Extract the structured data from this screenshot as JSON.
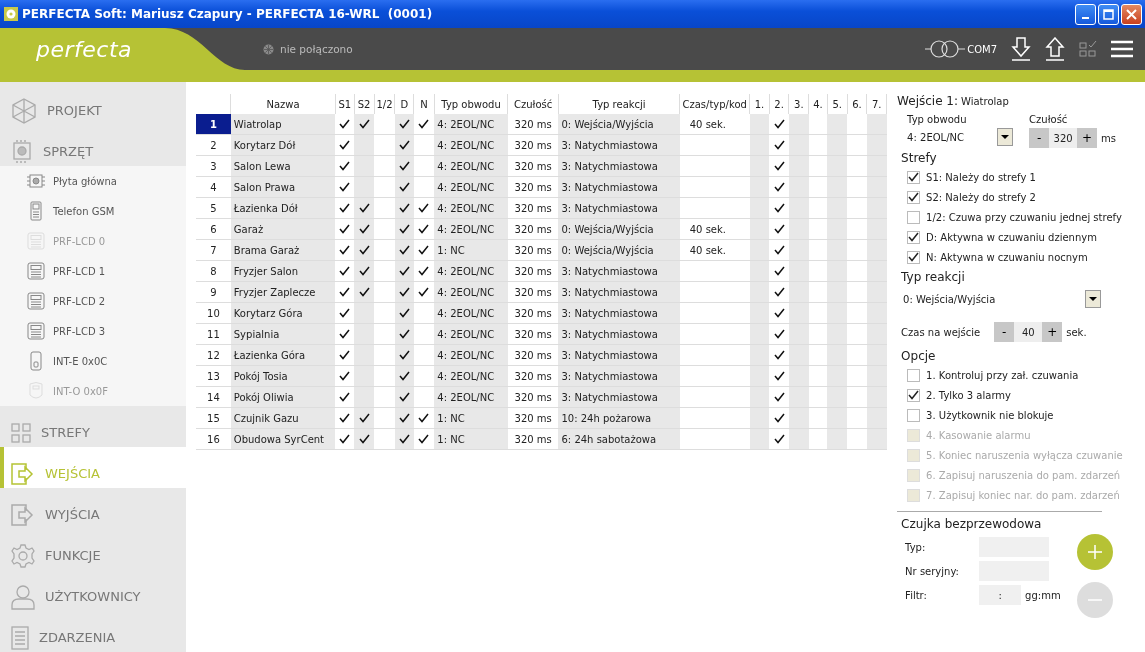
{
  "window": {
    "title": "PERFECTA Soft: Mariusz Czapury - PERFECTA 16-WRL  (0001)"
  },
  "header": {
    "logo": "perfecta",
    "status": "nie połączono",
    "port": "COM7"
  },
  "sidebar": {
    "items": [
      {
        "label": "PROJEKT",
        "kind": "main",
        "selected": false,
        "disabled": false
      },
      {
        "label": "SPRZĘT",
        "kind": "main",
        "selected": false,
        "disabled": false
      },
      {
        "label": "Płyta główna",
        "kind": "sub",
        "selected": false,
        "disabled": false
      },
      {
        "label": "Telefon GSM",
        "kind": "sub",
        "selected": false,
        "disabled": false
      },
      {
        "label": "PRF-LCD 0",
        "kind": "sub",
        "selected": false,
        "disabled": true
      },
      {
        "label": "PRF-LCD 1",
        "kind": "sub",
        "selected": false,
        "disabled": false
      },
      {
        "label": "PRF-LCD 2",
        "kind": "sub",
        "selected": false,
        "disabled": false
      },
      {
        "label": "PRF-LCD 3",
        "kind": "sub",
        "selected": false,
        "disabled": false
      },
      {
        "label": "INT-E 0x0C",
        "kind": "sub",
        "selected": false,
        "disabled": false
      },
      {
        "label": "INT-O 0x0F",
        "kind": "sub",
        "selected": false,
        "disabled": true
      },
      {
        "label": "STREFY",
        "kind": "main",
        "selected": false,
        "disabled": false
      },
      {
        "label": "WEJŚCIA",
        "kind": "main",
        "selected": true,
        "disabled": false
      },
      {
        "label": "WYJŚCIA",
        "kind": "main",
        "selected": false,
        "disabled": false
      },
      {
        "label": "FUNKCJE",
        "kind": "main",
        "selected": false,
        "disabled": false
      },
      {
        "label": "UŻYTKOWNICY",
        "kind": "main",
        "selected": false,
        "disabled": false
      },
      {
        "label": "ZDARZENIA",
        "kind": "main",
        "selected": false,
        "disabled": false
      }
    ]
  },
  "table": {
    "columns": [
      "Nazwa",
      "S1",
      "S2",
      "1/2",
      "D",
      "N",
      "Typ obwodu",
      "Czułość",
      "Typ reakcji",
      "Czas/typ/kod",
      "1.",
      "2.",
      "3.",
      "4.",
      "5.",
      "6.",
      "7."
    ],
    "rows": [
      {
        "num": "1",
        "name": "Wiatrolap",
        "selected": true,
        "flags": [
          true,
          true,
          false,
          true,
          true
        ],
        "type": "4: 2EOL/NC",
        "sens": "320 ms",
        "reaction": "0: Wejścia/Wyjścia",
        "time": "40 sek.",
        "outputs": [
          false,
          true,
          false,
          false,
          false,
          false,
          false
        ]
      },
      {
        "num": "2",
        "name": "Korytarz Dół",
        "selected": false,
        "flags": [
          true,
          false,
          false,
          true,
          false
        ],
        "type": "4: 2EOL/NC",
        "sens": "320 ms",
        "reaction": "3: Natychmiastowa",
        "time": "",
        "outputs": [
          false,
          true,
          false,
          false,
          false,
          false,
          false
        ]
      },
      {
        "num": "3",
        "name": "Salon Lewa",
        "selected": false,
        "flags": [
          true,
          false,
          false,
          true,
          false
        ],
        "type": "4: 2EOL/NC",
        "sens": "320 ms",
        "reaction": "3: Natychmiastowa",
        "time": "",
        "outputs": [
          false,
          true,
          false,
          false,
          false,
          false,
          false
        ]
      },
      {
        "num": "4",
        "name": "Salon Prawa",
        "selected": false,
        "flags": [
          true,
          false,
          false,
          true,
          false
        ],
        "type": "4: 2EOL/NC",
        "sens": "320 ms",
        "reaction": "3: Natychmiastowa",
        "time": "",
        "outputs": [
          false,
          true,
          false,
          false,
          false,
          false,
          false
        ]
      },
      {
        "num": "5",
        "name": "Łazienka Dół",
        "selected": false,
        "flags": [
          true,
          true,
          false,
          true,
          true
        ],
        "type": "4: 2EOL/NC",
        "sens": "320 ms",
        "reaction": "3: Natychmiastowa",
        "time": "",
        "outputs": [
          false,
          true,
          false,
          false,
          false,
          false,
          false
        ]
      },
      {
        "num": "6",
        "name": "Garaż",
        "selected": false,
        "flags": [
          true,
          true,
          false,
          true,
          true
        ],
        "type": "4: 2EOL/NC",
        "sens": "320 ms",
        "reaction": "0: Wejścia/Wyjścia",
        "time": "40 sek.",
        "outputs": [
          false,
          true,
          false,
          false,
          false,
          false,
          false
        ]
      },
      {
        "num": "7",
        "name": "Brama Garaż",
        "selected": false,
        "flags": [
          true,
          true,
          false,
          true,
          true
        ],
        "type": "1: NC",
        "sens": "320 ms",
        "reaction": "0: Wejścia/Wyjścia",
        "time": "40 sek.",
        "outputs": [
          false,
          true,
          false,
          false,
          false,
          false,
          false
        ]
      },
      {
        "num": "8",
        "name": "Fryzjer Salon",
        "selected": false,
        "flags": [
          true,
          true,
          false,
          true,
          true
        ],
        "type": "4: 2EOL/NC",
        "sens": "320 ms",
        "reaction": "3: Natychmiastowa",
        "time": "",
        "outputs": [
          false,
          true,
          false,
          false,
          false,
          false,
          false
        ]
      },
      {
        "num": "9",
        "name": "Fryzjer Zaplecze",
        "selected": false,
        "flags": [
          true,
          true,
          false,
          true,
          true
        ],
        "type": "4: 2EOL/NC",
        "sens": "320 ms",
        "reaction": "3: Natychmiastowa",
        "time": "",
        "outputs": [
          false,
          true,
          false,
          false,
          false,
          false,
          false
        ]
      },
      {
        "num": "10",
        "name": "Korytarz Góra",
        "selected": false,
        "flags": [
          true,
          false,
          false,
          true,
          false
        ],
        "type": "4: 2EOL/NC",
        "sens": "320 ms",
        "reaction": "3: Natychmiastowa",
        "time": "",
        "outputs": [
          false,
          true,
          false,
          false,
          false,
          false,
          false
        ]
      },
      {
        "num": "11",
        "name": "Sypialnia",
        "selected": false,
        "flags": [
          true,
          false,
          false,
          true,
          false
        ],
        "type": "4: 2EOL/NC",
        "sens": "320 ms",
        "reaction": "3: Natychmiastowa",
        "time": "",
        "outputs": [
          false,
          true,
          false,
          false,
          false,
          false,
          false
        ]
      },
      {
        "num": "12",
        "name": "Łazienka Góra",
        "selected": false,
        "flags": [
          true,
          false,
          false,
          true,
          false
        ],
        "type": "4: 2EOL/NC",
        "sens": "320 ms",
        "reaction": "3: Natychmiastowa",
        "time": "",
        "outputs": [
          false,
          true,
          false,
          false,
          false,
          false,
          false
        ]
      },
      {
        "num": "13",
        "name": "Pokój Tosia",
        "selected": false,
        "flags": [
          true,
          false,
          false,
          true,
          false
        ],
        "type": "4: 2EOL/NC",
        "sens": "320 ms",
        "reaction": "3: Natychmiastowa",
        "time": "",
        "outputs": [
          false,
          true,
          false,
          false,
          false,
          false,
          false
        ]
      },
      {
        "num": "14",
        "name": "Pokój Oliwia",
        "selected": false,
        "flags": [
          true,
          false,
          false,
          true,
          false
        ],
        "type": "4: 2EOL/NC",
        "sens": "320 ms",
        "reaction": "3: Natychmiastowa",
        "time": "",
        "outputs": [
          false,
          true,
          false,
          false,
          false,
          false,
          false
        ]
      },
      {
        "num": "15",
        "name": "Czujnik Gazu",
        "selected": false,
        "flags": [
          true,
          true,
          false,
          true,
          true
        ],
        "type": "1: NC",
        "sens": "320 ms",
        "reaction": "10: 24h pożarowa",
        "time": "",
        "outputs": [
          false,
          true,
          false,
          false,
          false,
          false,
          false
        ]
      },
      {
        "num": "16",
        "name": "Obudowa SyrCent",
        "selected": false,
        "flags": [
          true,
          true,
          false,
          true,
          true
        ],
        "type": "1: NC",
        "sens": "320 ms",
        "reaction": "6: 24h sabotażowa",
        "time": "",
        "outputs": [
          false,
          true,
          false,
          false,
          false,
          false,
          false
        ]
      }
    ]
  },
  "details": {
    "heading": "Wejście 1:",
    "name": "Wiatrolap",
    "circuit": {
      "label": "Typ obwodu",
      "value": "4: 2EOL/NC"
    },
    "sensitivity": {
      "label": "Czułość",
      "minus": "-",
      "value": "320",
      "plus": "+",
      "unit": "ms"
    },
    "zones_title": "Strefy",
    "zones": [
      {
        "label": "S1: Należy do strefy 1",
        "checked": true,
        "disabled": false
      },
      {
        "label": "S2: Należy do strefy 2",
        "checked": true,
        "disabled": false
      },
      {
        "label": "1/2: Czuwa przy czuwaniu jednej strefy",
        "checked": false,
        "disabled": false
      },
      {
        "label": "D: Aktywna w czuwaniu dziennym",
        "checked": true,
        "disabled": false
      },
      {
        "label": "N: Aktywna w czuwaniu nocnym",
        "checked": true,
        "disabled": false
      }
    ],
    "reaction_title": "Typ reakcji",
    "reaction": "0: Wejścia/Wyjścia",
    "entry_time": {
      "label": "Czas na wejście",
      "minus": "-",
      "value": "40",
      "plus": "+",
      "unit": "sek."
    },
    "options_title": "Opcje",
    "options": [
      {
        "label": "1. Kontroluj przy zał. czuwania",
        "checked": false,
        "disabled": false
      },
      {
        "label": "2. Tylko 3 alarmy",
        "checked": true,
        "disabled": false
      },
      {
        "label": "3. Użytkownik nie blokuje",
        "checked": false,
        "disabled": false
      },
      {
        "label": "4. Kasowanie alarmu",
        "checked": false,
        "disabled": true
      },
      {
        "label": "5. Koniec naruszenia wyłącza czuwanie",
        "checked": false,
        "disabled": true
      },
      {
        "label": "6. Zapisuj naruszenia do pam. zdarzeń",
        "checked": false,
        "disabled": true
      },
      {
        "label": "7. Zapisuj koniec nar. do pam. zdarzeń",
        "checked": false,
        "disabled": true
      }
    ],
    "wireless": {
      "title": "Czujka bezprzewodowa",
      "type_label": "Typ:",
      "serial_label": "Nr seryjny:",
      "filter_label": "Filtr:",
      "filter_value": ":",
      "filter_unit": "gg:mm",
      "add_disabled": false,
      "remove_disabled": true
    }
  }
}
